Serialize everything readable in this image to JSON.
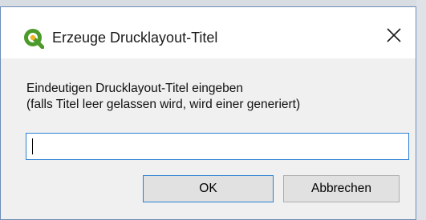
{
  "dialog": {
    "title": "Erzeuge Drucklayout-Titel",
    "icon": "qgis-logo-icon",
    "close_icon": "close-icon",
    "accent_color": "#2a7fd4",
    "logo_green": "#4c9a2a",
    "logo_yellow": "#f0b323"
  },
  "prompt": {
    "line1": "Eindeutigen Drucklayout-Titel eingeben",
    "line2": "(falls Titel leer gelassen wird, wird einer generiert)"
  },
  "input": {
    "value": "",
    "placeholder": ""
  },
  "buttons": {
    "ok_label": "OK",
    "cancel_label": "Abbrechen"
  }
}
